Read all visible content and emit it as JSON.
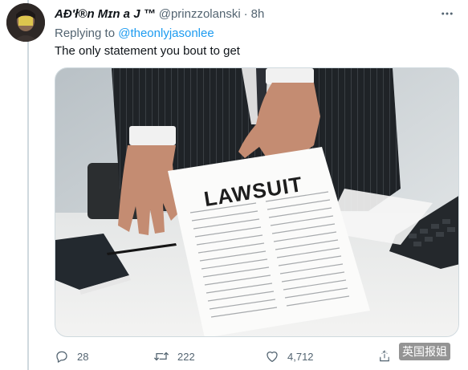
{
  "tweet": {
    "display_name": "AÐ'ł®n Mɪn a J ™",
    "handle": "@prinzzolanski",
    "separator": "·",
    "time": "8h",
    "replying_prefix": "Replying to",
    "replying_to": "@theonlyjasonlee",
    "text": "The only statement you bout to get"
  },
  "media": {
    "document_title": "LAWSUIT"
  },
  "actions": {
    "replies": "28",
    "retweets": "222",
    "likes": "4,712"
  },
  "watermark": {
    "text": "英国报姐"
  },
  "icons": {
    "avatar": "profile-avatar",
    "more": "more-icon",
    "reply": "reply-icon",
    "retweet": "retweet-icon",
    "like": "heart-icon",
    "share": "share-icon"
  },
  "colors": {
    "text_primary": "#0f1419",
    "text_secondary": "#536471",
    "link": "#1d9bf0",
    "border": "#cfd9de"
  }
}
